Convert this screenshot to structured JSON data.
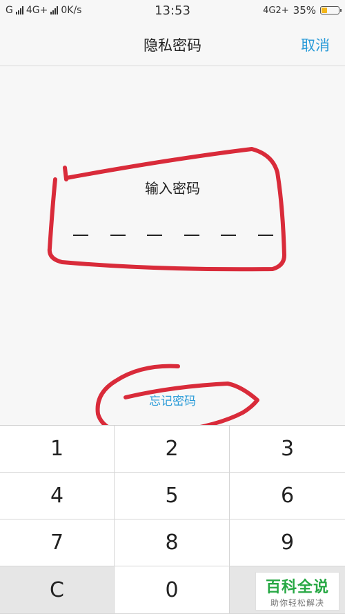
{
  "status_bar": {
    "network1": "G",
    "network2": "4G+",
    "speed": "0K/s",
    "time": "13:53",
    "network3": "4G2+",
    "battery": "35%",
    "battery_level": 0.35,
    "battery_color": "#f3b61a"
  },
  "nav": {
    "title": "隐私密码",
    "cancel": "取消"
  },
  "passcode": {
    "prompt": "输入密码",
    "digits_entered": 0,
    "digits_total": 6
  },
  "forgot": "忘记密码",
  "keypad": {
    "keys": [
      "1",
      "2",
      "3",
      "4",
      "5",
      "6",
      "7",
      "8",
      "9",
      "C",
      "0",
      ""
    ]
  },
  "watermark": {
    "title": "百科全说",
    "subtitle": "助你轻松解决"
  },
  "colors": {
    "accent": "#2a9bd8",
    "annotation": "#d92b3a"
  }
}
